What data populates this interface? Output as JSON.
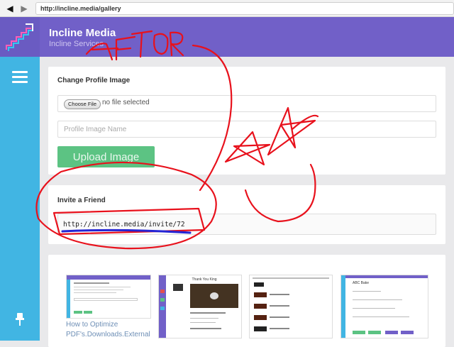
{
  "browser": {
    "url": "http://incline.media/gallery",
    "back_icon": "back-arrow-icon",
    "forward_icon": "forward-arrow-icon"
  },
  "app": {
    "title": "Incline Media",
    "subtitle": "Incline Services",
    "colors": {
      "header": "#7160c8",
      "sidebar": "#41b5e3",
      "upload": "#5cc383",
      "annotation": "#e8111c",
      "underline": "#2424d4"
    }
  },
  "sidebar": {
    "menu_icon": "hamburger-menu-icon",
    "pin_icon": "pin-icon"
  },
  "profile": {
    "heading": "Change Profile Image",
    "choose_button": "Choose File",
    "file_status": "no file selected",
    "name_placeholder": "Profile Image Name",
    "upload_button": "Upload Image"
  },
  "invite": {
    "heading": "Invite a Friend",
    "link": "http://incline.media/invite/72"
  },
  "gallery": {
    "items": [
      {
        "caption_line1": "How to Optimize",
        "caption_line2": "PDF's.Downloads.External"
      },
      {
        "title": "Thank You King"
      },
      {},
      {
        "title": "ABC Bake"
      }
    ]
  },
  "annotations": {
    "handwritten_text": "AFTOR"
  }
}
